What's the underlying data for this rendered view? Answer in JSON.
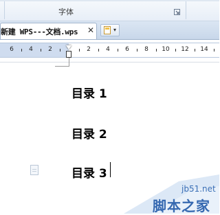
{
  "ribbon": {
    "group_label": "字体",
    "launcher_icon": "dialog-launcher-icon"
  },
  "tab": {
    "document_title": "新建 WPS---文档.wps",
    "close_label": "✕"
  },
  "new_tab": {
    "icon": "new-document-icon",
    "arrow": "▾"
  },
  "ruler": {
    "labels": [
      "6",
      "4",
      "2",
      "2",
      "4",
      "6",
      "8",
      "10",
      "12",
      "14"
    ]
  },
  "document": {
    "lines": [
      "目录 1",
      "目录 2",
      "目录 3"
    ]
  },
  "watermark": {
    "site": "jb51.net",
    "name": "脚本之家"
  },
  "colors": {
    "accent": "#3568b0",
    "ruler_bg": "#cfdcef"
  }
}
